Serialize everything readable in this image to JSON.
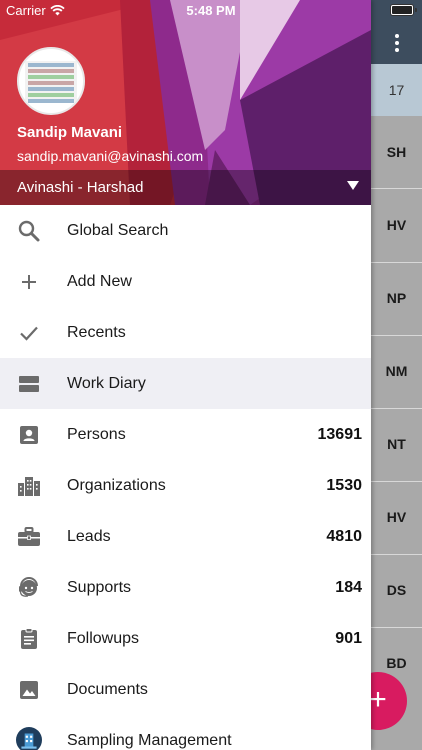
{
  "status_bar": {
    "carrier": "Carrier",
    "time": "5:48 PM"
  },
  "background_app": {
    "date_fragment": "17",
    "row_initials": [
      "SH",
      "HV",
      "NP",
      "NM",
      "NT",
      "HV",
      "DS",
      "BD"
    ],
    "fab_label": "+"
  },
  "drawer": {
    "user_name": "Sandip Mavani",
    "user_email": "sandip.mavani@avinashi.com",
    "account": "Avinashi - Harshad",
    "items": [
      {
        "label": "Global Search",
        "count": "",
        "icon": "search-icon"
      },
      {
        "label": "Add New",
        "count": "",
        "icon": "plus-icon"
      },
      {
        "label": "Recents",
        "count": "",
        "icon": "check-icon"
      },
      {
        "label": "Work Diary",
        "count": "",
        "icon": "diary-icon",
        "active": true
      },
      {
        "label": "Persons",
        "count": "13691",
        "icon": "person-icon"
      },
      {
        "label": "Organizations",
        "count": "1530",
        "icon": "buildings-icon"
      },
      {
        "label": "Leads",
        "count": "4810",
        "icon": "briefcase-icon"
      },
      {
        "label": "Supports",
        "count": "184",
        "icon": "support-agent-icon"
      },
      {
        "label": "Followups",
        "count": "901",
        "icon": "clipboard-icon"
      },
      {
        "label": "Documents",
        "count": "",
        "icon": "image-icon"
      },
      {
        "label": "Sampling Management",
        "count": "",
        "icon": "sampling-icon"
      }
    ]
  },
  "colors": {
    "header_red": "#c62b3a",
    "header_purple": "#7b1fa2",
    "active_row": "#efeff4",
    "fab": "#d81b60",
    "icon_gray": "#6b6b6b"
  }
}
